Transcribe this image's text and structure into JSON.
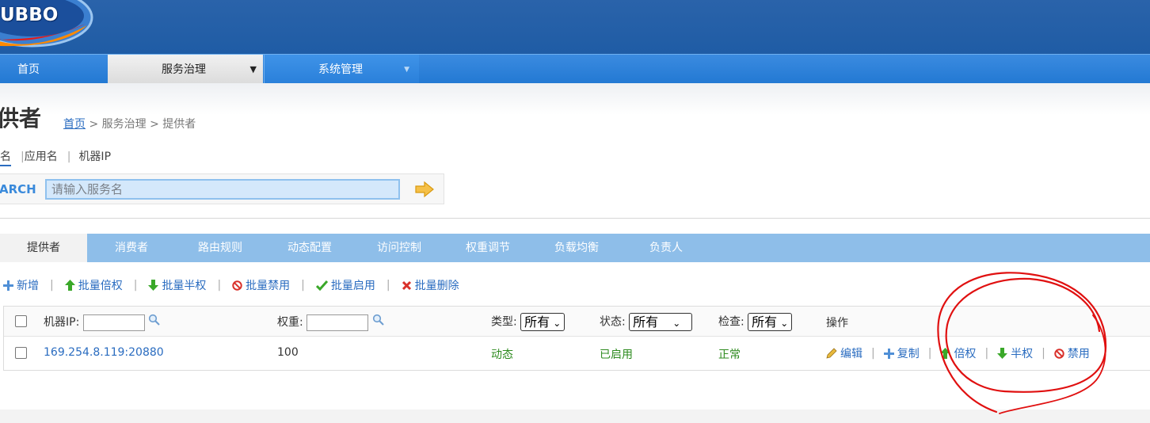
{
  "logo": {
    "text": "UBBO"
  },
  "nav": {
    "home": "首页",
    "service_governance": "服务治理",
    "system_management": "系统管理"
  },
  "page": {
    "title": "供者",
    "breadcrumb": {
      "home": "首页",
      "rest": " > 服务治理 > 提供者"
    }
  },
  "search": {
    "tabs": [
      "名",
      "应用名",
      "机器IP"
    ],
    "label": "ARCH",
    "placeholder": "请输入服务名"
  },
  "tabs": [
    "提供者",
    "消费者",
    "路由规则",
    "动态配置",
    "访问控制",
    "权重调节",
    "负载均衡",
    "负责人"
  ],
  "toolbar": {
    "add": "新增",
    "batch_double": "批量倍权",
    "batch_half": "批量半权",
    "batch_disable": "批量禁用",
    "batch_enable": "批量启用",
    "batch_delete": "批量删除"
  },
  "table": {
    "headers": {
      "ip": "机器IP:",
      "weight": "权重:",
      "type": "类型:",
      "status": "状态:",
      "check": "检查:",
      "ops": "操作"
    },
    "filters": {
      "type": "所有",
      "status": "所有",
      "check": "所有"
    },
    "row": {
      "ip": "169.254.8.119:20880",
      "weight": "100",
      "type": "动态",
      "status": "已启用",
      "check": "正常",
      "ops": {
        "edit": "编辑",
        "copy": "复制",
        "double": "倍权",
        "half": "半权",
        "disable": "禁用"
      }
    }
  },
  "colors": {
    "header_blue": "#1f5ca5",
    "nav_blue": "#2379d3",
    "tab_bar": "#8ebee9",
    "link_blue": "#2a6cc0",
    "status_green": "#2e8b1f",
    "annotation_red": "#e01010"
  }
}
